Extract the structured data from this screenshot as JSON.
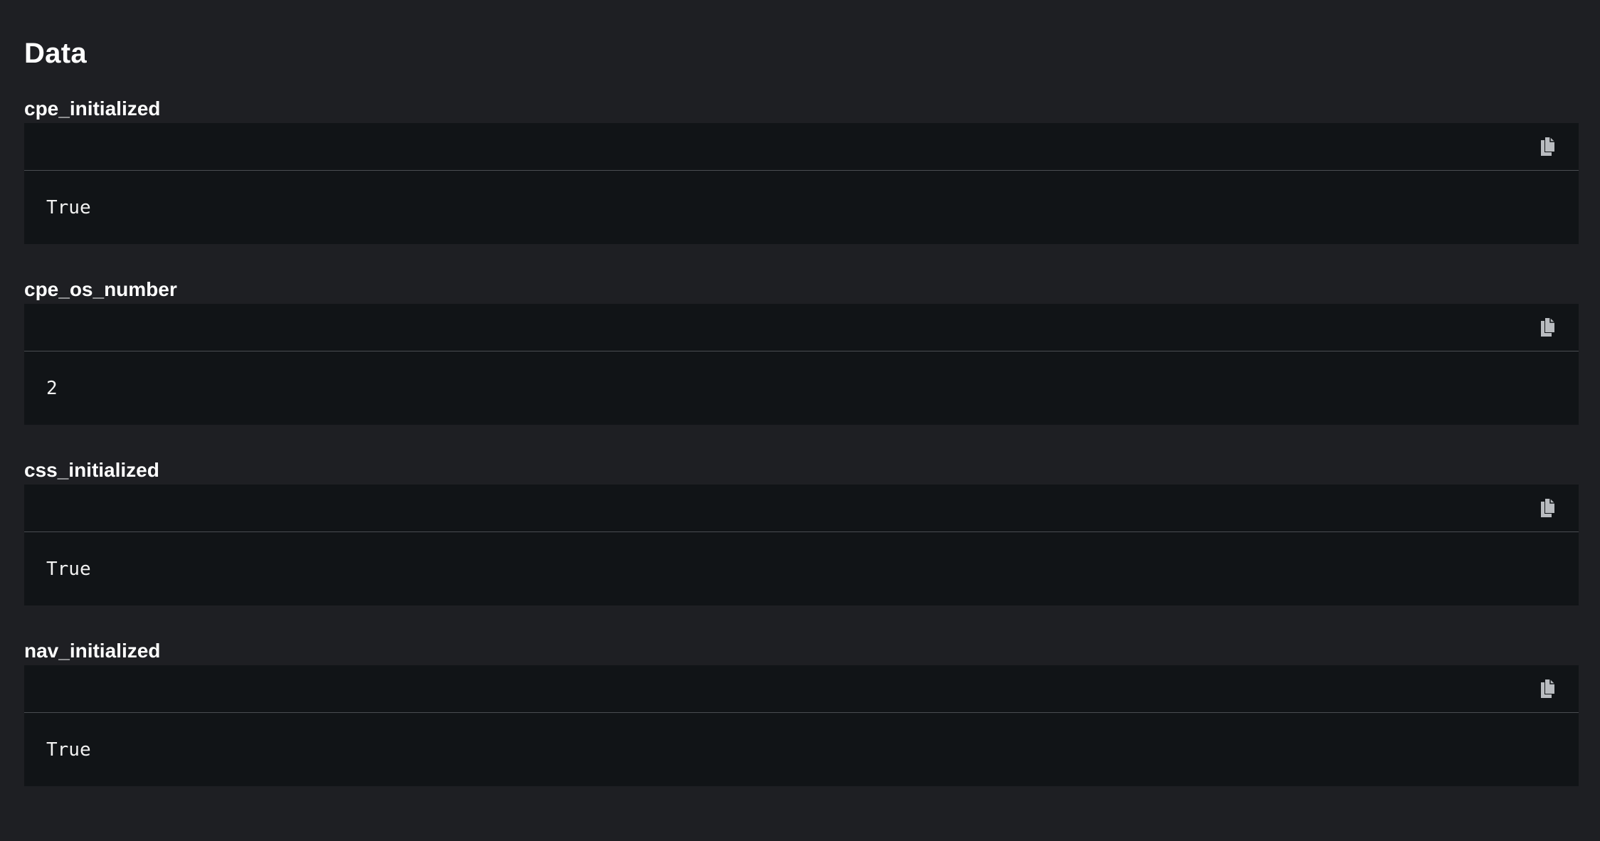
{
  "page": {
    "title": "Data"
  },
  "entries": [
    {
      "label": "cpe_initialized",
      "value": "True",
      "copy_icon": "copy-icon"
    },
    {
      "label": "cpe_os_number",
      "value": "2",
      "copy_icon": "copy-icon"
    },
    {
      "label": "css_initialized",
      "value": "True",
      "copy_icon": "copy-icon"
    },
    {
      "label": "nav_initialized",
      "value": "True",
      "copy_icon": "copy-icon"
    }
  ],
  "colors": {
    "background": "#1e1f23",
    "code_background": "#111417",
    "divider": "#4a4d52",
    "icon": "#b9bcc0",
    "text": "#ffffff"
  }
}
